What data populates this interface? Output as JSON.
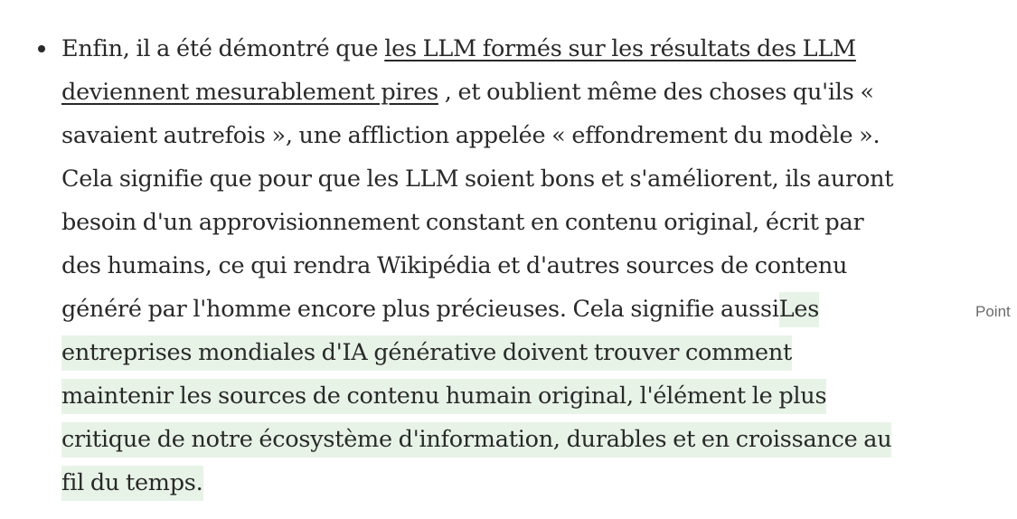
{
  "article": {
    "bullet": {
      "lines": [
        {
          "pre": "Enfin, il a été démontré que ",
          "link": "les LLM formés sur les résultats des LLM"
        },
        {
          "link": "deviennent mesurablement pires",
          "post": " , et oublient même des choses qu'ils «"
        },
        {
          "text": "savaient autrefois », une affliction appelée « effondrement du modèle »."
        },
        {
          "text": "Cela signifie que pour que les LLM soient bons et s'améliorent, ils auront"
        },
        {
          "text": "besoin d'un approvisionnement constant en contenu original, écrit par"
        },
        {
          "text": "des humains, ce qui rendra Wikipédia et d'autres sources de contenu"
        },
        {
          "pre": "généré par l'homme encore plus précieuses. Cela signifie aussi",
          "hl": "Les"
        },
        {
          "hl": "entreprises mondiales d'IA générative doivent trouver comment"
        },
        {
          "hl": "maintenir les sources de contenu humain original, l'élément le plus"
        },
        {
          "hl": "critique de notre écosystème d'information, durables et en croissance au"
        },
        {
          "hl": "fil du temps."
        }
      ]
    },
    "side_note": "Point"
  }
}
